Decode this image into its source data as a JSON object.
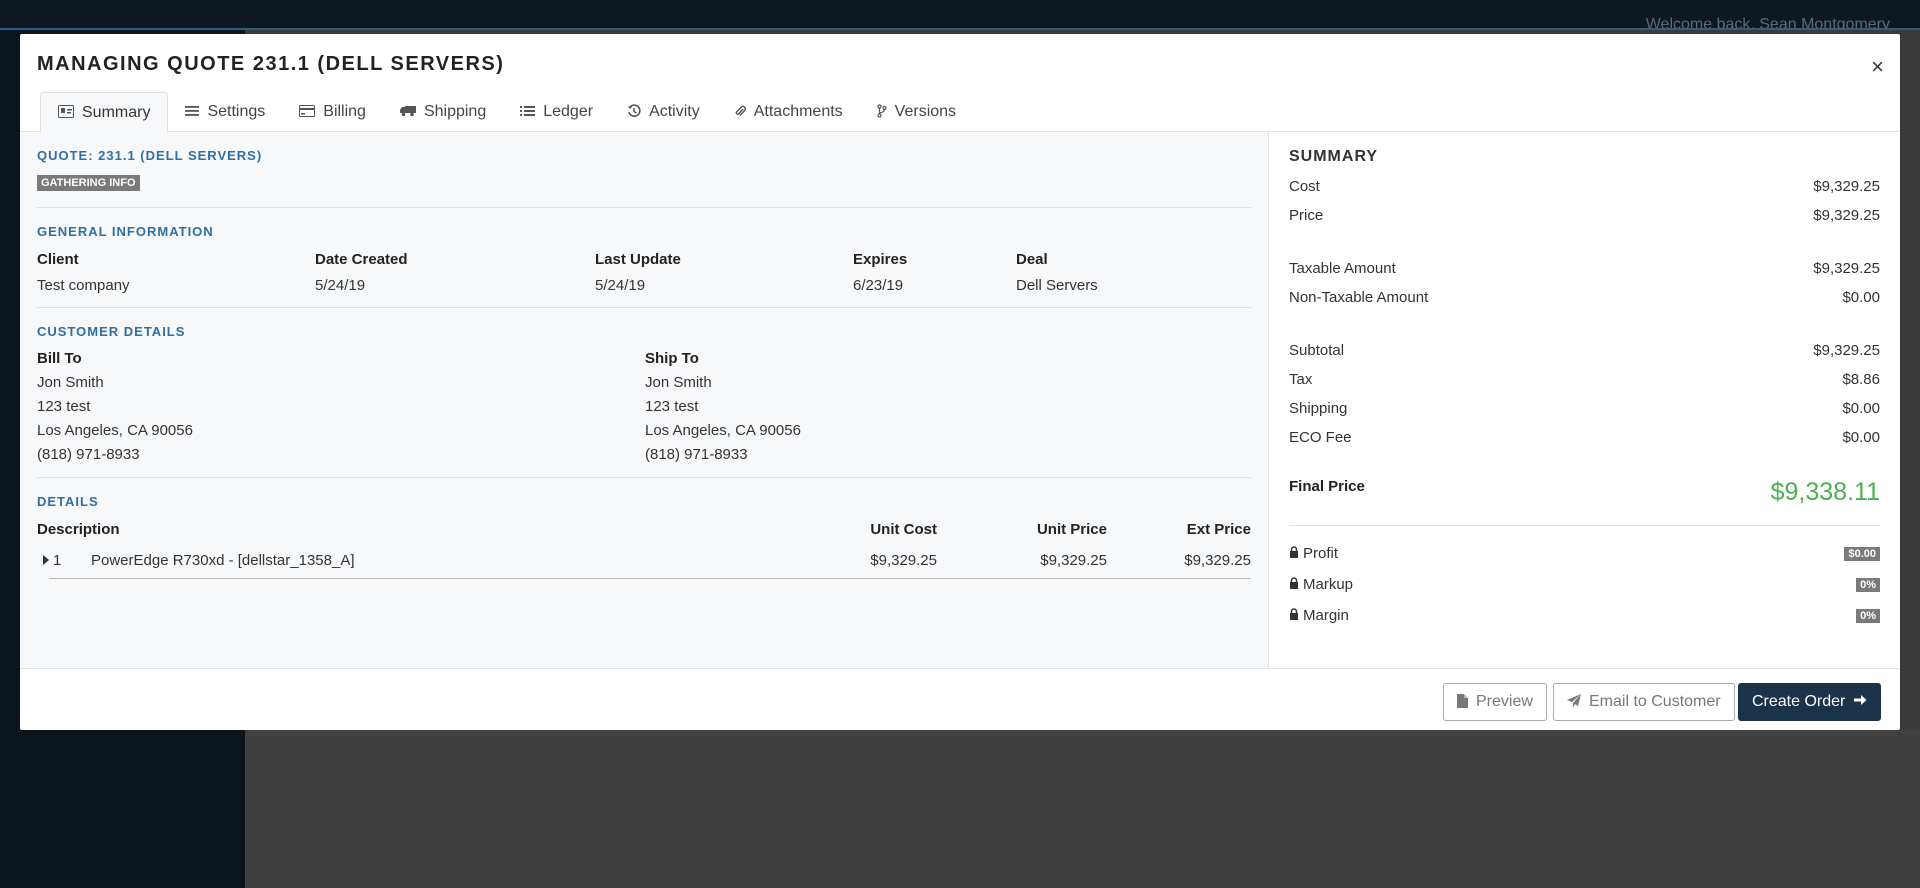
{
  "background": {
    "welcome": "Welcome back, Sean Montgomery"
  },
  "modal": {
    "title": "MANAGING QUOTE 231.1 (DELL SERVERS)",
    "close": "×",
    "tabs": [
      {
        "label": "Summary",
        "icon": "id-card-icon"
      },
      {
        "label": "Settings",
        "icon": "bars-icon"
      },
      {
        "label": "Billing",
        "icon": "credit-card-icon"
      },
      {
        "label": "Shipping",
        "icon": "truck-icon"
      },
      {
        "label": "Ledger",
        "icon": "list-icon"
      },
      {
        "label": "Activity",
        "icon": "history-icon"
      },
      {
        "label": "Attachments",
        "icon": "paperclip-icon"
      },
      {
        "label": "Versions",
        "icon": "code-branch-icon"
      }
    ]
  },
  "quote": {
    "heading": "QUOTE: 231.1 (DELL SERVERS)",
    "status": "GATHERING INFO"
  },
  "general": {
    "heading": "GENERAL INFORMATION",
    "client_label": "Client",
    "client": "Test company",
    "created_label": "Date Created",
    "created": "5/24/19",
    "updated_label": "Last Update",
    "updated": "5/24/19",
    "expires_label": "Expires",
    "expires": "6/23/19",
    "deal_label": "Deal",
    "deal": "Dell Servers"
  },
  "customer": {
    "heading": "CUSTOMER DETAILS",
    "bill_label": "Bill To",
    "bill": [
      "Jon Smith",
      "123 test",
      "Los Angeles, CA 90056",
      "(818) 971-8933"
    ],
    "ship_label": "Ship To",
    "ship": [
      "Jon Smith",
      "123 test",
      "Los Angeles, CA 90056",
      "(818) 971-8933"
    ]
  },
  "details": {
    "heading": "DETAILS",
    "col_description": "Description",
    "col_unit_cost": "Unit Cost",
    "col_unit_price": "Unit Price",
    "col_ext_price": "Ext Price",
    "rows": [
      {
        "qty": "1",
        "description": "PowerEdge R730xd - [dellstar_1358_A]",
        "unit_cost": "$9,329.25",
        "unit_price": "$9,329.25",
        "ext_price": "$9,329.25"
      }
    ]
  },
  "summary": {
    "heading": "SUMMARY",
    "cost_label": "Cost",
    "cost": "$9,329.25",
    "price_label": "Price",
    "price": "$9,329.25",
    "taxable_label": "Taxable Amount",
    "taxable": "$9,329.25",
    "nontaxable_label": "Non-Taxable Amount",
    "nontaxable": "$0.00",
    "subtotal_label": "Subtotal",
    "subtotal": "$9,329.25",
    "tax_label": "Tax",
    "tax": "$8.86",
    "shipping_label": "Shipping",
    "shipping": "$0.00",
    "eco_label": "ECO Fee",
    "eco": "$0.00",
    "final_label": "Final Price",
    "final": "$9,338.11",
    "profit_label": "Profit",
    "profit": "$0.00",
    "markup_label": "Markup",
    "markup": "0%",
    "margin_label": "Margin",
    "margin": "0%"
  },
  "footer": {
    "preview": "Preview",
    "email": "Email to Customer",
    "create_order": "Create Order"
  }
}
